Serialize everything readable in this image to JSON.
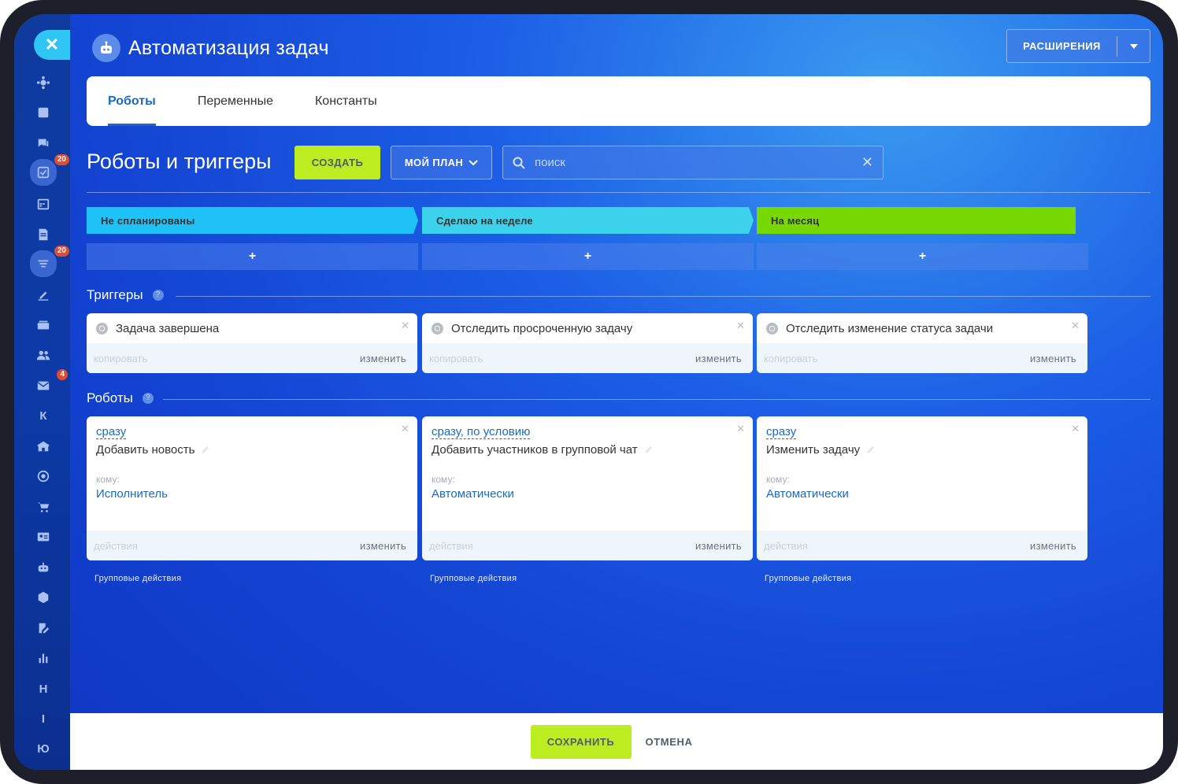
{
  "app": {
    "title": "Автоматизация задач",
    "extensions_label": "РАСШИРЕНИЯ"
  },
  "tabs": [
    {
      "label": "Роботы",
      "active": true
    },
    {
      "label": "Переменные",
      "active": false
    },
    {
      "label": "Константы",
      "active": false
    }
  ],
  "toolbar": {
    "section_title": "Роботы и триггеры",
    "create_label": "СОЗДАТЬ",
    "plan_label": "МОЙ ПЛАН",
    "search_placeholder": "поиск"
  },
  "stages": [
    {
      "label": "Не спланированы",
      "color": "#1fc2f7"
    },
    {
      "label": "Сделаю на неделе",
      "color": "#3dd2ec"
    },
    {
      "label": "На месяц",
      "color": "#76d904"
    }
  ],
  "add_symbol": "+",
  "triggers": {
    "title": "Триггеры",
    "help": "?",
    "items": [
      {
        "name": "Задача завершена",
        "copy": "копировать",
        "edit": "изменить"
      },
      {
        "name": "Отследить просроченную задачу",
        "copy": "копировать",
        "edit": "изменить"
      },
      {
        "name": "Отследить изменение статуса задачи",
        "copy": "копировать",
        "edit": "изменить"
      }
    ]
  },
  "robots": {
    "title": "Роботы",
    "help": "?",
    "items": [
      {
        "when": "сразу",
        "name": "Добавить новость",
        "to_label": "кому:",
        "to_value": "Исполнитель",
        "actions": "действия",
        "edit": "изменить",
        "group": "Групповые действия"
      },
      {
        "when": "сразу, по условию",
        "name": "Добавить участников в групповой чат",
        "to_label": "кому:",
        "to_value": "Автоматически",
        "actions": "действия",
        "edit": "изменить",
        "group": "Групповые действия"
      },
      {
        "when": "сразу",
        "name": "Изменить задачу",
        "to_label": "кому:",
        "to_value": "Автоматически",
        "actions": "действия",
        "edit": "изменить",
        "group": "Групповые действия"
      }
    ]
  },
  "sidebar": {
    "close": "✕",
    "badges": {
      "tasks": "20",
      "filter": "20",
      "mail": "4"
    },
    "letters": [
      "К",
      "Н",
      "І",
      "Ю"
    ],
    "icons": [
      "settings-icon",
      "feed-icon",
      "chat-icon",
      "tasks-icon",
      "calendar-icon",
      "document-icon",
      "filter-icon",
      "sign-icon",
      "drive-icon",
      "people-icon",
      "mail-icon",
      "k-letter",
      "store-icon",
      "target-icon",
      "cart-icon",
      "contact-card-icon",
      "robot-icon",
      "box-icon",
      "edit-doc-icon",
      "analytics-icon",
      "h-letter",
      "i-letter",
      "yu-letter"
    ]
  },
  "footer": {
    "save_label": "СОХРАНИТЬ",
    "cancel_label": "ОТМЕНА"
  }
}
